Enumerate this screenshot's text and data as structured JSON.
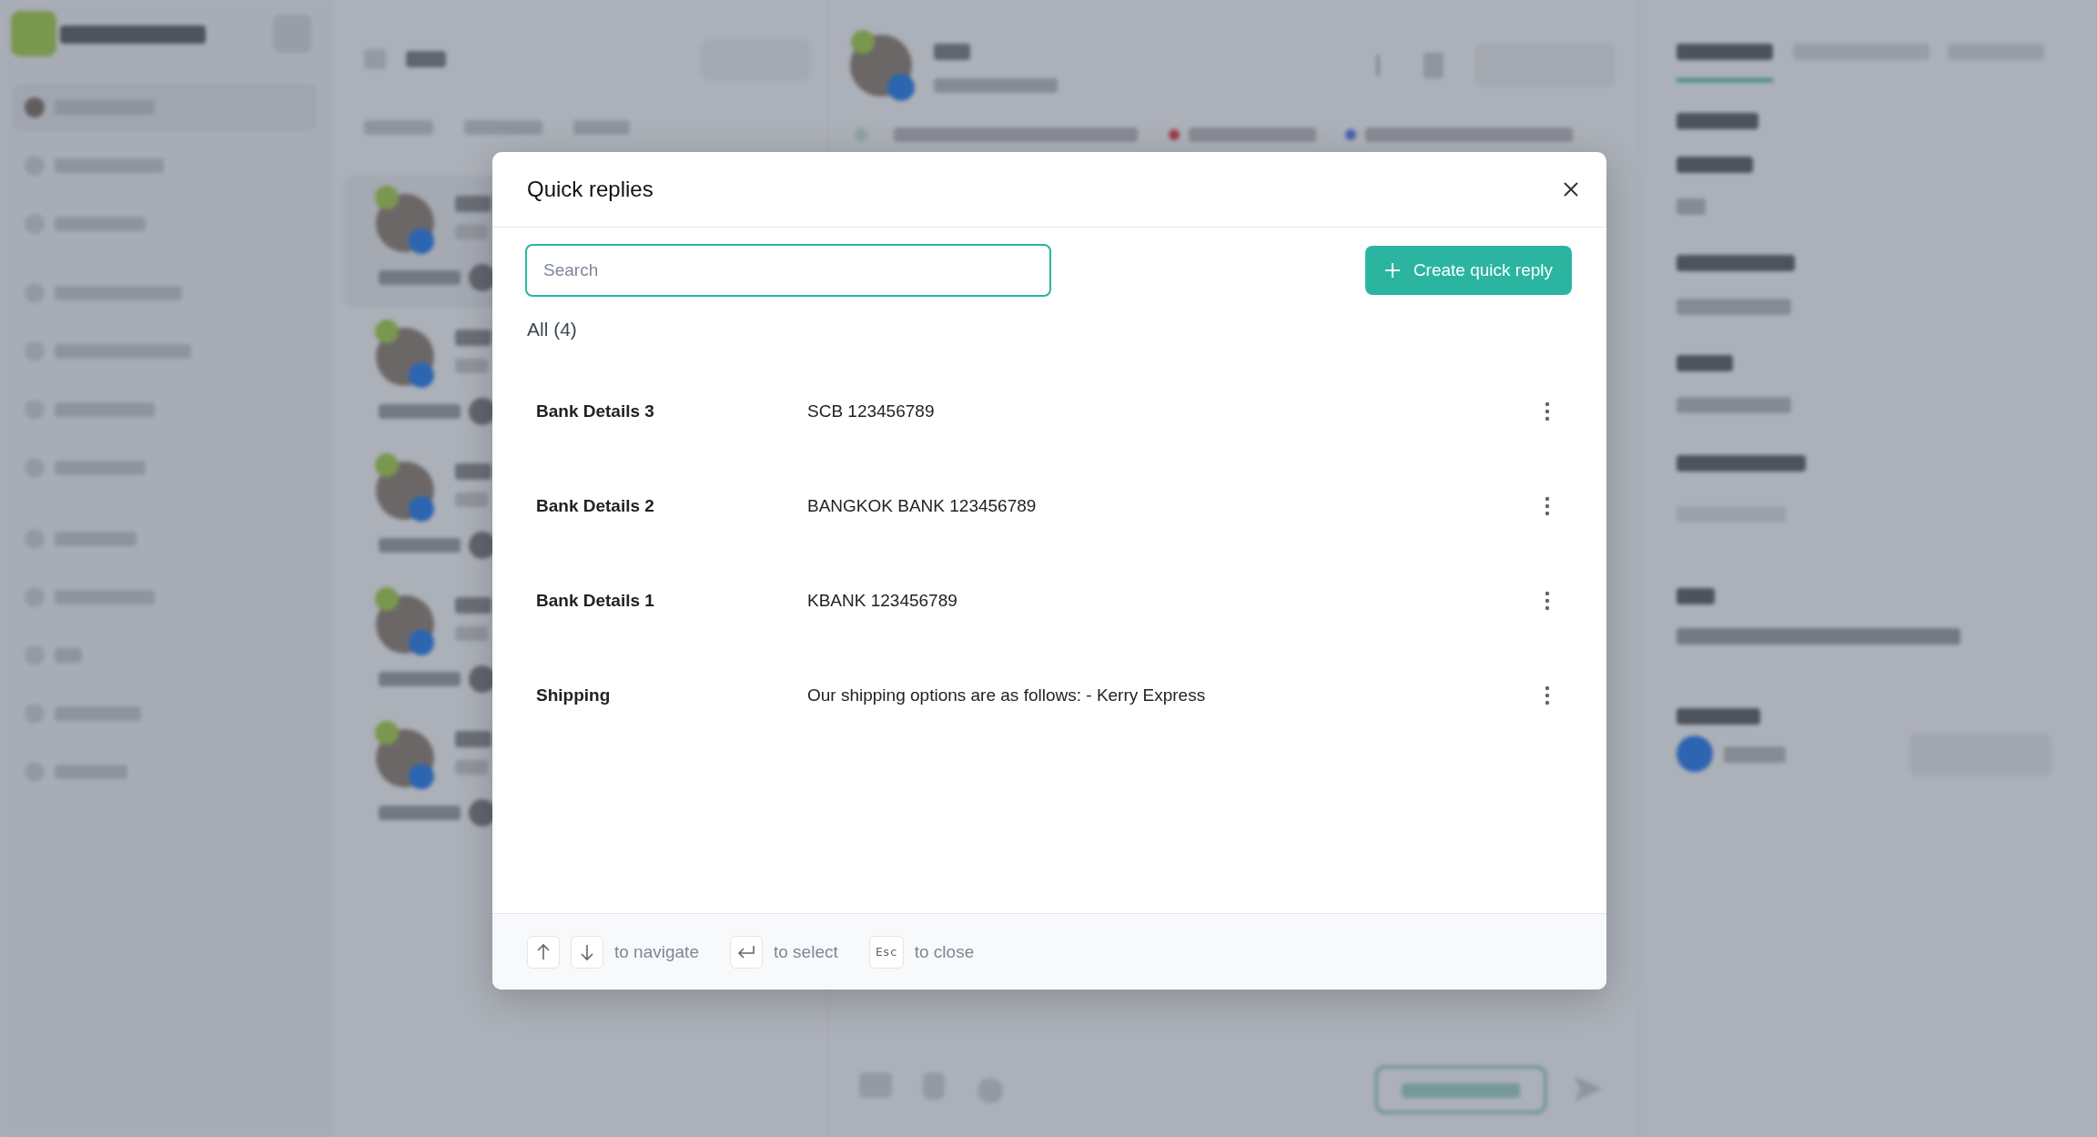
{
  "modal": {
    "title": "Quick replies",
    "search": {
      "placeholder": "Search"
    },
    "create": "Create quick reply",
    "count": "All (4)",
    "replies": [
      {
        "name": "Bank Details 3",
        "text": "SCB 123456789"
      },
      {
        "name": "Bank Details 2",
        "text": "BANGKOK BANK 123456789"
      },
      {
        "name": "Bank Details 1",
        "text": "KBANK 123456789"
      },
      {
        "name": "Shipping",
        "text": "Our shipping options are as follows: - Kerry Express"
      }
    ],
    "hints": [
      {
        "keys": [
          {
            "kind": "up"
          },
          {
            "kind": "down"
          }
        ],
        "label": "to navigate"
      },
      {
        "keys": [
          {
            "kind": "enter"
          }
        ],
        "label": "to select"
      },
      {
        "keys": [
          {
            "kind": "text",
            "text": "Esc"
          }
        ],
        "label": "to close"
      }
    ]
  }
}
